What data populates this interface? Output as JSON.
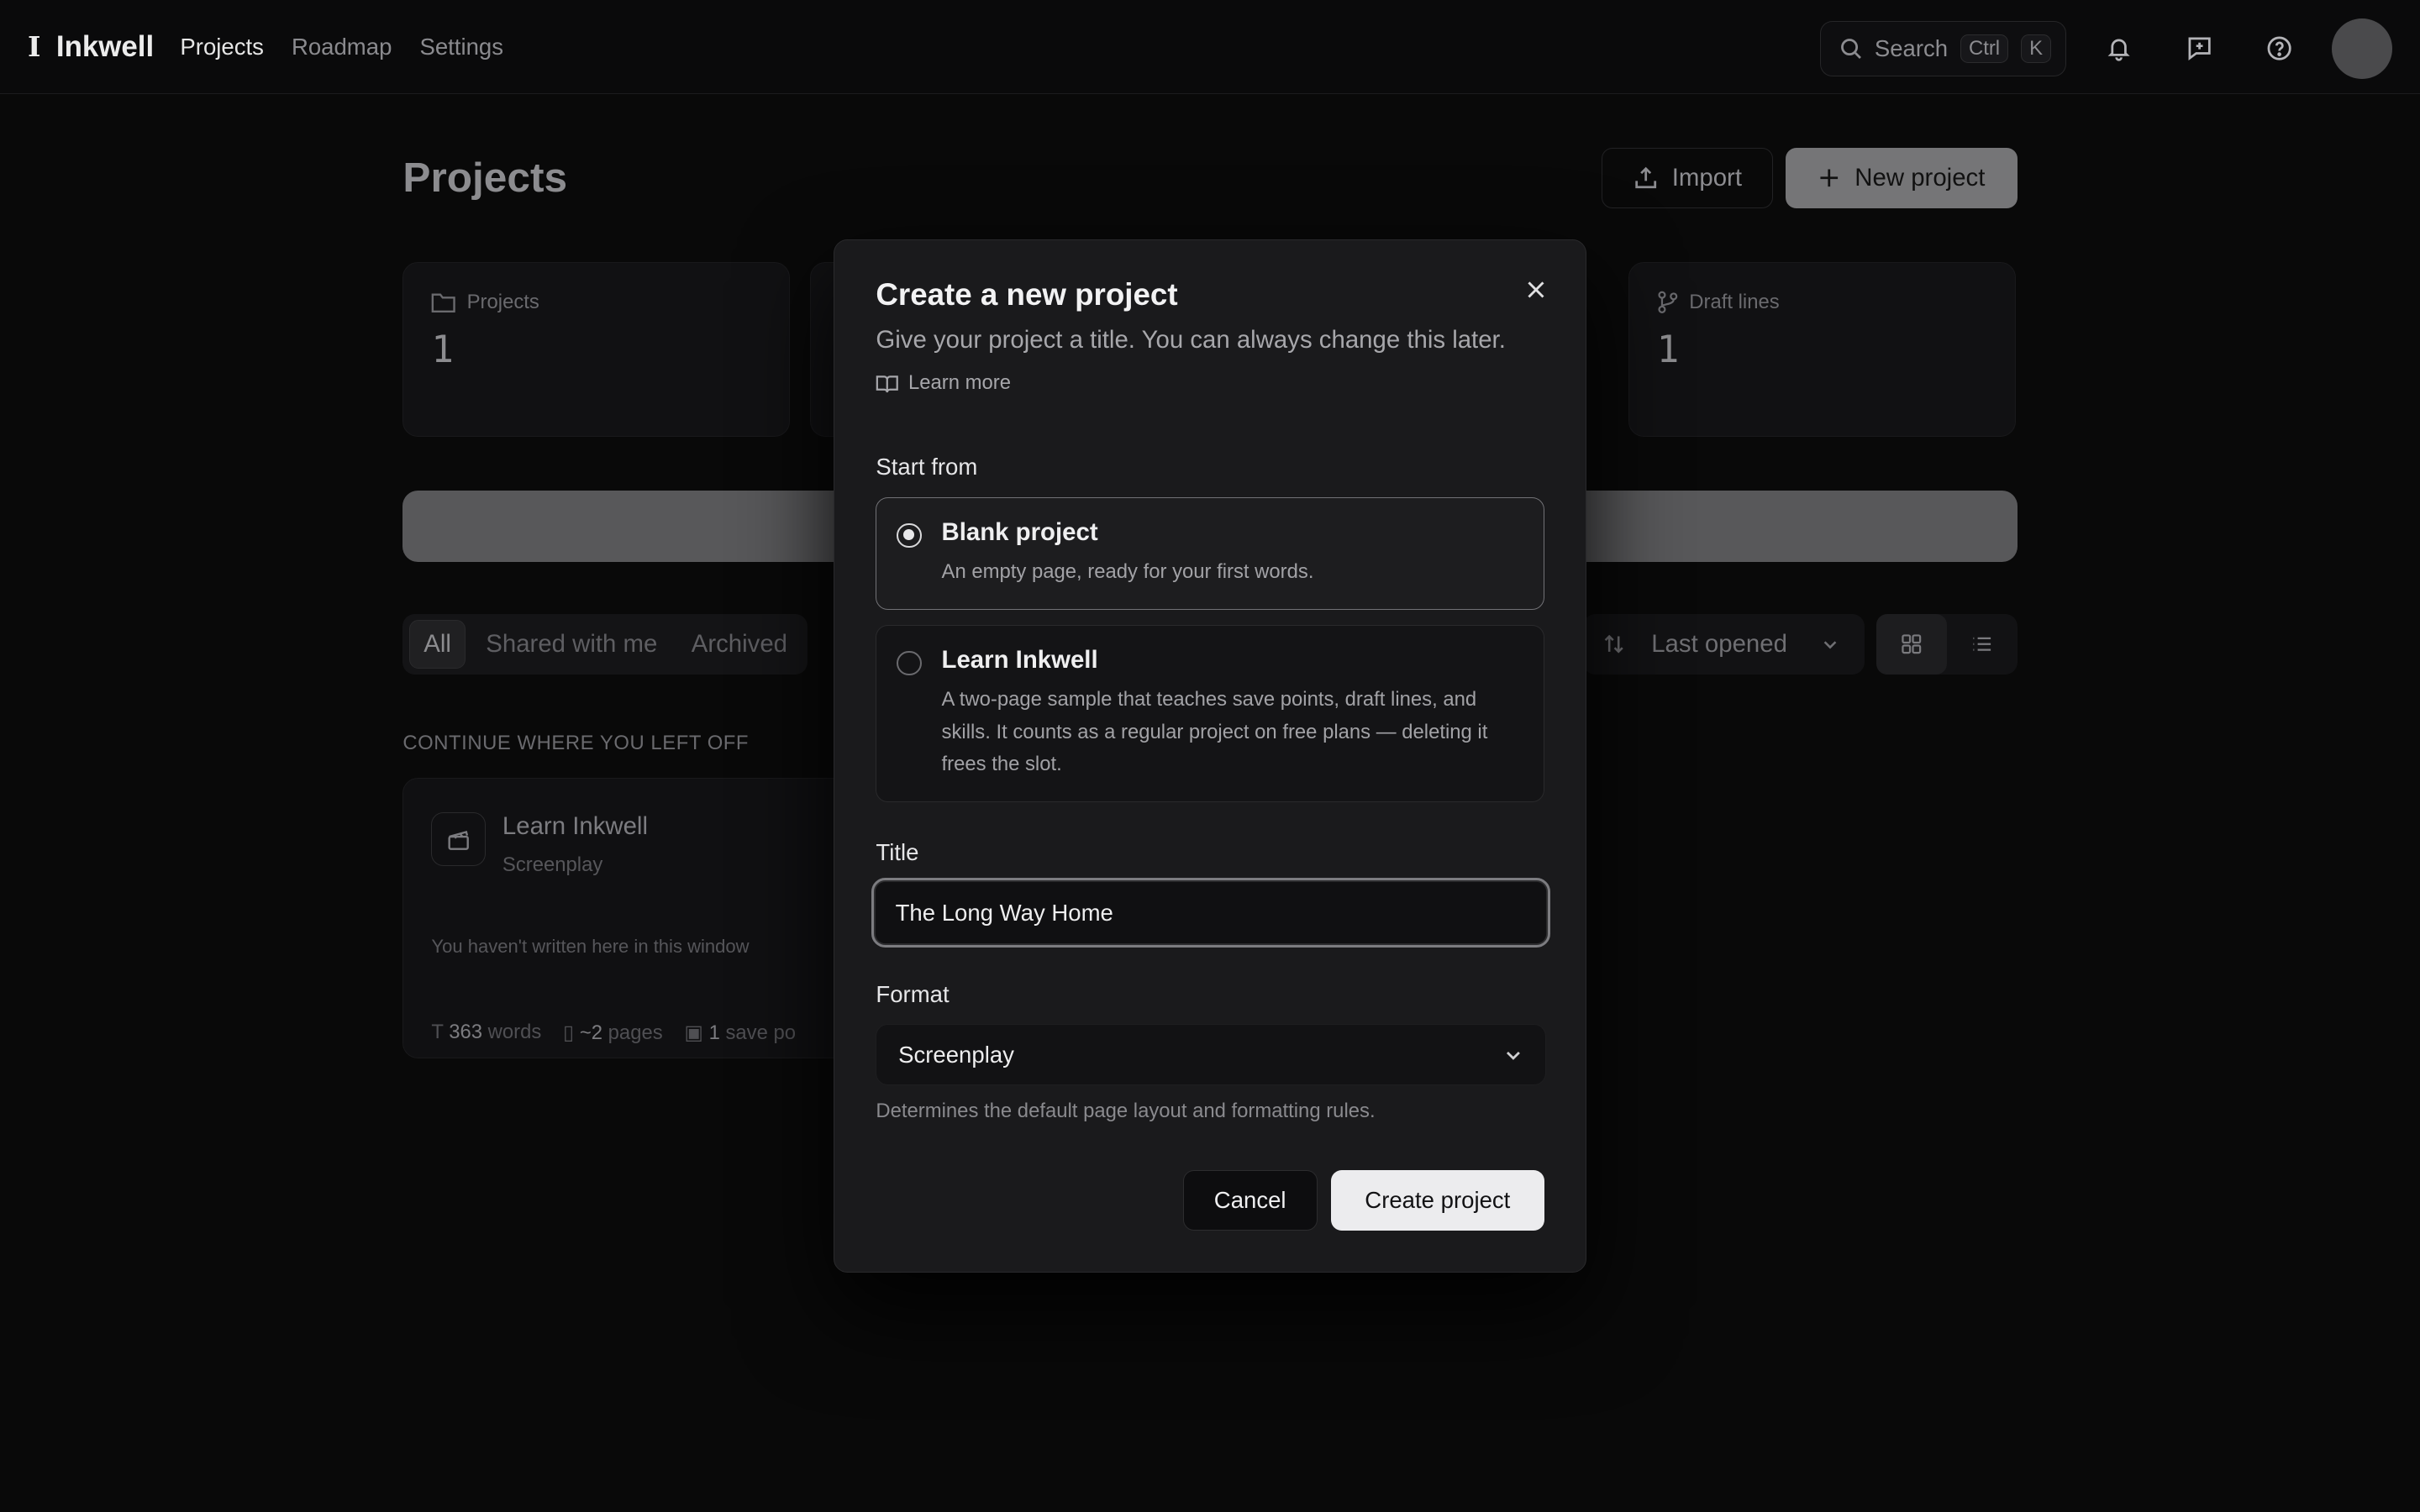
{
  "app": {
    "name": "Inkwell"
  },
  "nav": [
    "Projects",
    "Roadmap",
    "Settings"
  ],
  "search": {
    "label": "Search",
    "kbd1": "Ctrl",
    "kbd2": "K"
  },
  "page": {
    "title": "Projects",
    "import_label": "Import",
    "new_label": "New project",
    "stats": [
      {
        "label": "Projects",
        "value": "1"
      },
      {
        "label": "Draft lines",
        "value": "1"
      }
    ],
    "filters": [
      "All",
      "Shared with me",
      "Archived"
    ],
    "sort_label": "Last opened",
    "section_heading": "CONTINUE WHERE YOU LEFT OFF",
    "card": {
      "title": "Learn Inkwell",
      "type": "Screenplay",
      "note": "You haven't written here in this window",
      "words_num": "363",
      "words_label": "words",
      "pages_num": "~2",
      "pages_label": "pages",
      "saves_num": "1",
      "saves_label": "save po"
    }
  },
  "modal": {
    "title": "Create a new project",
    "subtitle": "Give your project a title. You can always change this later.",
    "learn_more": "Learn more",
    "start_from_label": "Start from",
    "options": [
      {
        "title": "Blank project",
        "desc": "An empty page, ready for your first words.",
        "selected": true
      },
      {
        "title": "Learn Inkwell",
        "desc": "A two-page sample that teaches save points, draft lines, and skills. It counts as a regular project on free plans — deleting it frees the slot.",
        "selected": false
      }
    ],
    "title_label": "Title",
    "title_value": "The Long Way Home",
    "format_label": "Format",
    "format_value": "Screenplay",
    "format_hint": "Determines the default page layout and formatting rules.",
    "cancel_label": "Cancel",
    "create_label": "Create project"
  }
}
